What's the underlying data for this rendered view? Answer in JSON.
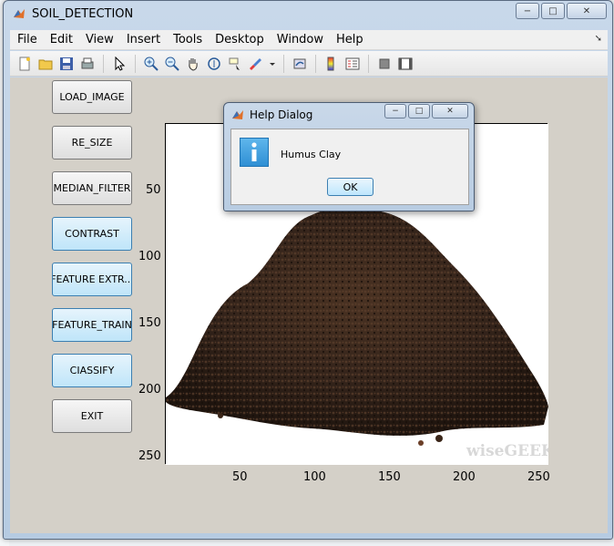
{
  "window": {
    "title": "SOIL_DETECTION",
    "minimize": "−",
    "maximize": "□",
    "close": "✕"
  },
  "menu": [
    "File",
    "Edit",
    "View",
    "Insert",
    "Tools",
    "Desktop",
    "Window",
    "Help"
  ],
  "toolbar_icons": [
    "new-file-icon",
    "open-folder-icon",
    "save-icon",
    "print-icon",
    "pointer-icon",
    "zoom-in-icon",
    "zoom-out-icon",
    "pan-hand-icon",
    "rotate-3d-icon",
    "data-cursor-icon",
    "brush-icon",
    "dropdown-arrow-icon",
    "link-plot-icon",
    "colorbar-icon",
    "legend-icon",
    "hide-plot-tools-icon",
    "show-plot-tools-icon"
  ],
  "buttons": [
    {
      "label": "LOAD_IMAGE",
      "state": "normal"
    },
    {
      "label": "RE_SIZE",
      "state": "normal"
    },
    {
      "label": "MEDIAN_FILTER",
      "state": "normal"
    },
    {
      "label": "CONTRAST",
      "state": "highlighted"
    },
    {
      "label": "FEATURE EXTR...",
      "state": "highlighted"
    },
    {
      "label": "FEATURE_TRAIN",
      "state": "highlighted"
    },
    {
      "label": "CIASSIFY",
      "state": "highlighted"
    },
    {
      "label": "EXIT",
      "state": "normal"
    }
  ],
  "axes": {
    "yticks": [
      "50",
      "100",
      "150",
      "200",
      "250"
    ],
    "xticks": [
      "50",
      "100",
      "150",
      "200",
      "250"
    ],
    "watermark": "wiseGEEK"
  },
  "dialog": {
    "title": "Help Dialog",
    "message": "Humus Clay",
    "ok_label": "OK"
  },
  "colors": {
    "button_highlight": "#bfe5f9",
    "client_bg": "#d4d0c8",
    "info_blue": "#2f8fd4"
  }
}
